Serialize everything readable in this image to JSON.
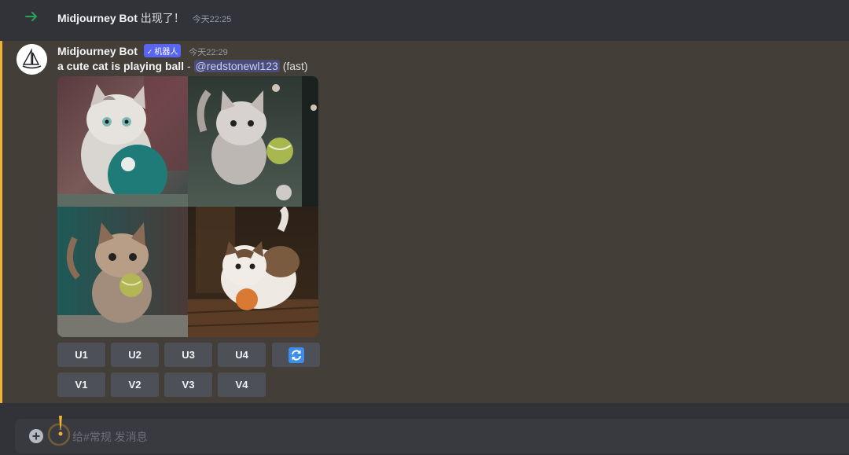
{
  "system_message": {
    "author": "Midjourney Bot",
    "text": "出现了！",
    "timestamp": "今天22:25"
  },
  "message": {
    "author": "Midjourney Bot",
    "bot_tag": "机器人",
    "timestamp": "今天22:29",
    "prompt": "a cute cat is playing ball",
    "separator": "-",
    "mention": "@redstonewl123",
    "speed": "(fast)",
    "images": [
      {
        "icon": "cat-with-teal-ball-image"
      },
      {
        "icon": "cat-with-tennis-ball-image"
      },
      {
        "icon": "kitten-holding-ball-image"
      },
      {
        "icon": "cat-with-orange-ball-image"
      }
    ],
    "upscale_buttons": [
      "U1",
      "U2",
      "U3",
      "U4"
    ],
    "variation_buttons": [
      "V1",
      "V2",
      "V3",
      "V4"
    ],
    "reroll_icon": "refresh-icon"
  },
  "composer": {
    "placeholder": "#常规 发消息",
    "prefix": "给"
  },
  "colors": {
    "background": "#313338",
    "highlight": "#433f38",
    "highlight_border": "#f0b232",
    "button": "#4e5058",
    "bot_tag": "#5865f2",
    "join_arrow": "#23a55a",
    "refresh": "#3b8eea"
  }
}
